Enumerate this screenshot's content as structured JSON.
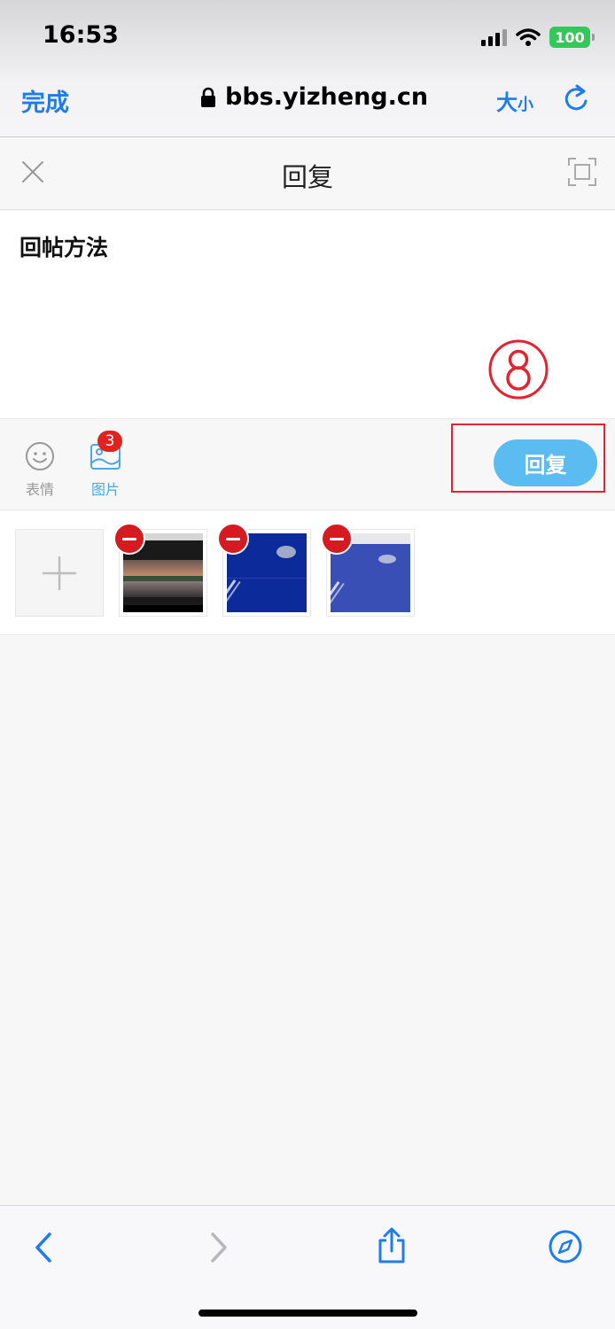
{
  "status_bar": {
    "time": "16:53",
    "battery": "100"
  },
  "browser": {
    "done_label": "完成",
    "url": "bbs.yizheng.cn",
    "text_size_big": "大",
    "text_size_small": "小"
  },
  "reply_page": {
    "title": "回复",
    "content_text": "回帖方法",
    "step_marker": "⑧",
    "toolbar": {
      "emoji_label": "表情",
      "image_label": "图片",
      "image_count": "3",
      "reply_button": "回复"
    }
  },
  "colors": {
    "accent": "#1e7cf0",
    "reply_button": "#5bbcf1",
    "highlight": "#e3232f",
    "remove": "#d61a22",
    "battery": "#34c759"
  },
  "icons": [
    "lock-icon",
    "reload-icon",
    "close-icon",
    "fullscreen-icon",
    "emoji-icon",
    "image-icon",
    "plus-icon",
    "remove-icon",
    "back-icon",
    "forward-icon",
    "share-icon",
    "compass-icon"
  ]
}
